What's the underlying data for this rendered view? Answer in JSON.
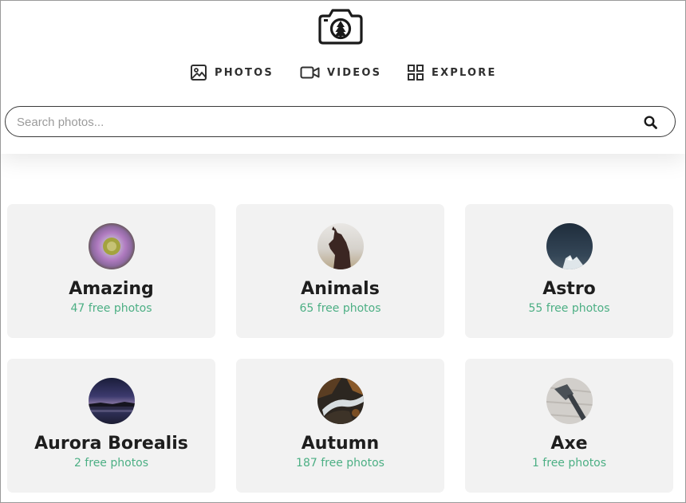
{
  "nav": {
    "items": [
      {
        "label": "PHOTOS",
        "icon": "image-icon"
      },
      {
        "label": "VIDEOS",
        "icon": "video-camera-icon"
      },
      {
        "label": "EXPLORE",
        "icon": "grid-icon"
      }
    ]
  },
  "search": {
    "placeholder": "Search photos...",
    "value": "",
    "icon": "search-icon"
  },
  "categories": [
    {
      "title": "Amazing",
      "count": "47 free photos",
      "thumbnail": "daisy flower"
    },
    {
      "title": "Animals",
      "count": "65 free photos",
      "thumbnail": "horse"
    },
    {
      "title": "Astro",
      "count": "55 free photos",
      "thumbnail": "night sky"
    },
    {
      "title": "Aurora Borealis",
      "count": "2 free photos",
      "thumbnail": "twilight lake"
    },
    {
      "title": "Autumn",
      "count": "187 free photos",
      "thumbnail": "waterfall"
    },
    {
      "title": "Axe",
      "count": "1 free photos",
      "thumbnail": "axe on wood"
    }
  ],
  "colors": {
    "count_text": "#4caf84",
    "card_background": "#f2f2f2",
    "title_text": "#1e1e1e"
  }
}
